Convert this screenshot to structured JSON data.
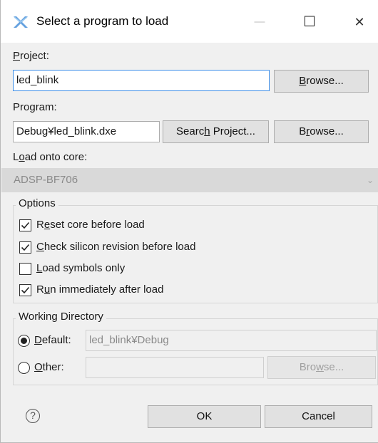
{
  "window": {
    "title": "Select a program to load",
    "minimize": "—",
    "maximize": "☐",
    "close": "✕"
  },
  "project": {
    "label_key": "P",
    "label_rest": "roject:",
    "value": "led_blink",
    "browse_key": "B",
    "browse_rest": "rowse..."
  },
  "program": {
    "label_pre": "Pro",
    "label_key": "g",
    "label_post": "ram:",
    "value": "Debug¥led_blink.dxe",
    "search_pre": "Searc",
    "search_key": "h",
    "search_post": " Project...",
    "browse_pre": "B",
    "browse_key": "r",
    "browse_post": "owse..."
  },
  "core": {
    "label_pre": "L",
    "label_key": "o",
    "label_post": "ad onto core:",
    "value": "ADSP-BF706"
  },
  "options": {
    "legend": "Options",
    "items": [
      {
        "pre": "R",
        "key": "e",
        "post": "set core before load",
        "checked": true
      },
      {
        "pre": "",
        "key": "C",
        "post": "heck silicon revision before load",
        "checked": true
      },
      {
        "pre": "",
        "key": "L",
        "post": "oad symbols only",
        "checked": false
      },
      {
        "pre": "R",
        "key": "u",
        "post": "n immediately after load",
        "checked": true
      }
    ]
  },
  "working_directory": {
    "legend": "Working Directory",
    "default_key": "D",
    "default_rest": "efault:",
    "default_value": "led_blink¥Debug",
    "other_key": "O",
    "other_rest": "ther:",
    "other_value": "",
    "browse_pre": "Bro",
    "browse_key": "w",
    "browse_post": "se...",
    "selected": "default"
  },
  "footer": {
    "help": "?",
    "ok": "OK",
    "cancel": "Cancel"
  }
}
